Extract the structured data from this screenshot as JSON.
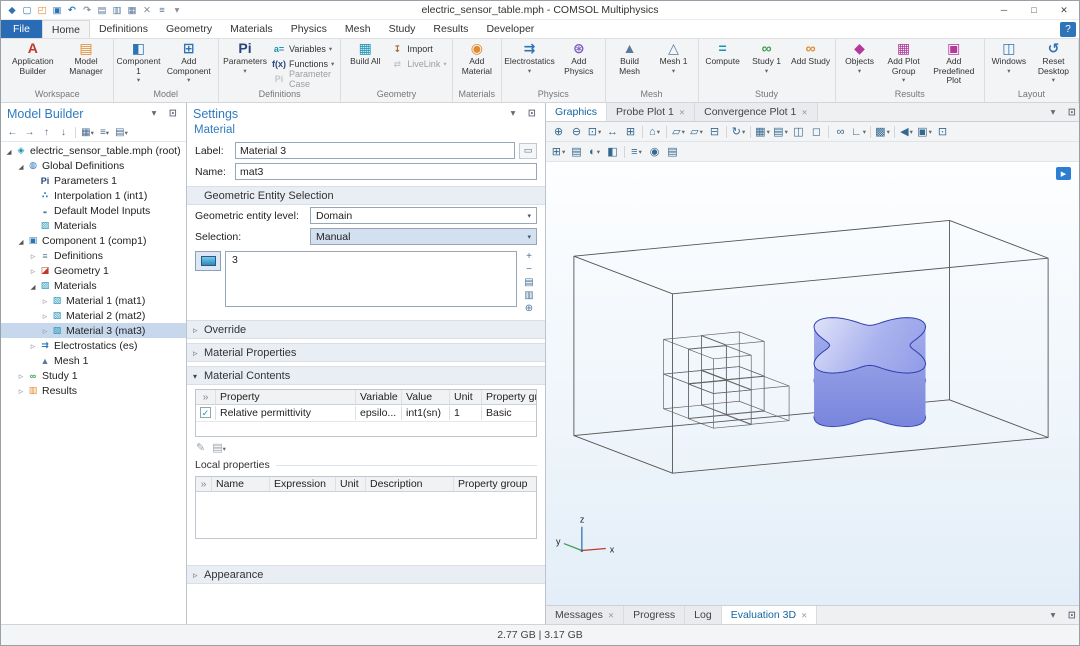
{
  "window": {
    "title": "electric_sensor_table.mph - COMSOL Multiphysics",
    "min": "─",
    "max": "□",
    "close": "✕",
    "quick_toolbar": [
      {
        "name": "app-icon",
        "g": "◆",
        "c": "blue"
      },
      {
        "name": "new-file-icon",
        "g": "▢",
        "c": "blue"
      },
      {
        "name": "open-file-icon",
        "g": "◰",
        "c": "orange"
      },
      {
        "name": "save-icon",
        "g": "▣",
        "c": "blue"
      },
      {
        "name": "undo-icon",
        "g": "↶",
        "c": "blue"
      },
      {
        "name": "redo-icon",
        "g": "↷",
        "c": "gray"
      },
      {
        "name": "copy-icon",
        "g": "▤",
        "c": "slate"
      },
      {
        "name": "paste-icon",
        "g": "▥",
        "c": "slate"
      },
      {
        "name": "duplicate-icon",
        "g": "▦",
        "c": "slate"
      },
      {
        "name": "delete-icon",
        "g": "✕",
        "c": "gray"
      },
      {
        "name": "options-icon",
        "g": "≡",
        "c": "slate"
      },
      {
        "name": "qat-menu-icon",
        "g": "▾",
        "c": "gray"
      }
    ]
  },
  "menubar": {
    "help": "?",
    "tabs": [
      {
        "label": "File",
        "cls": "file",
        "name": "tab-file"
      },
      {
        "label": "Home",
        "selected": true,
        "name": "tab-home"
      },
      {
        "label": "Definitions",
        "name": "tab-definitions"
      },
      {
        "label": "Geometry",
        "name": "tab-geometry"
      },
      {
        "label": "Materials",
        "name": "tab-materials"
      },
      {
        "label": "Physics",
        "name": "tab-physics"
      },
      {
        "label": "Mesh",
        "name": "tab-mesh"
      },
      {
        "label": "Study",
        "name": "tab-study"
      },
      {
        "label": "Results",
        "name": "tab-results"
      },
      {
        "label": "Developer",
        "name": "tab-developer"
      }
    ]
  },
  "ribbon": {
    "groups": [
      {
        "label": "Workspace",
        "big": [
          {
            "name": "application-builder-button",
            "label": "Application Builder",
            "g": "A",
            "c": "red"
          },
          {
            "name": "model-manager-button",
            "label": "Model Manager",
            "g": "▤",
            "c": "orange"
          }
        ],
        "small": []
      },
      {
        "label": "Model",
        "big": [
          {
            "name": "component-1-button",
            "label": "Component 1",
            "g": "◧",
            "c": "blue",
            "arrow": true
          },
          {
            "name": "add-component-button",
            "label": "Add Component",
            "g": "⊞",
            "c": "blue",
            "arrow": true
          }
        ],
        "small": []
      },
      {
        "label": "Definitions",
        "big": [
          {
            "name": "parameters-button",
            "label": "Parameters",
            "g": "Pi",
            "c": "navy",
            "arrow": true
          }
        ],
        "small": [
          {
            "name": "variables-button",
            "label": "Variables",
            "g": "a=",
            "c": "teal",
            "arrow": true
          },
          {
            "name": "functions-button",
            "label": "Functions",
            "g": "f(x)",
            "c": "navy",
            "arrow": true
          },
          {
            "name": "parameter-case-button",
            "label": "Parameter Case",
            "g": "Pi",
            "c": "gray",
            "disabled": true
          }
        ]
      },
      {
        "label": "Geometry",
        "big": [
          {
            "name": "build-all-button",
            "label": "Build All",
            "g": "▦",
            "c": "teal"
          }
        ],
        "small": [
          {
            "name": "import-button",
            "label": "Import",
            "g": "↧",
            "c": "brown"
          },
          {
            "name": "livelink-button",
            "label": "LiveLink",
            "g": "⇄",
            "c": "gray",
            "arrow": true,
            "disabled": true
          }
        ]
      },
      {
        "label": "Materials",
        "big": [
          {
            "name": "add-material-button",
            "label": "Add Material",
            "g": "◉",
            "c": "orange"
          }
        ],
        "small": []
      },
      {
        "label": "Physics",
        "big": [
          {
            "name": "electrostatics-button",
            "label": "Electrostatics",
            "g": "⇉",
            "c": "blue",
            "arrow": true
          },
          {
            "name": "add-physics-button",
            "label": "Add Physics",
            "g": "⊛",
            "c": "purple"
          }
        ],
        "small": []
      },
      {
        "label": "Mesh",
        "big": [
          {
            "name": "build-mesh-button",
            "label": "Build Mesh",
            "g": "▲",
            "c": "slate"
          },
          {
            "name": "mesh-1-button",
            "label": "Mesh 1",
            "g": "△",
            "c": "slate",
            "arrow": true
          }
        ],
        "small": []
      },
      {
        "label": "Study",
        "big": [
          {
            "name": "compute-button",
            "label": "Compute",
            "g": "=",
            "c": "teal"
          },
          {
            "name": "study-1-button",
            "label": "Study 1",
            "g": "∞",
            "c": "green",
            "arrow": true
          },
          {
            "name": "add-study-button",
            "label": "Add Study",
            "g": "∞",
            "c": "orange"
          }
        ],
        "small": []
      },
      {
        "label": "Results",
        "big": [
          {
            "name": "objects-button",
            "label": "Objects",
            "g": "◆",
            "c": "magenta",
            "arrow": true
          },
          {
            "name": "add-plot-group-button",
            "label": "Add Plot Group",
            "g": "▦",
            "c": "magenta",
            "arrow": true
          },
          {
            "name": "add-predefined-plot-button",
            "label": "Add Predefined Plot",
            "g": "▣",
            "c": "magenta"
          }
        ],
        "small": []
      },
      {
        "label": "Layout",
        "big": [
          {
            "name": "windows-button",
            "label": "Windows",
            "g": "◫",
            "c": "blue",
            "arrow": true
          },
          {
            "name": "reset-desktop-button",
            "label": "Reset Desktop",
            "g": "↺",
            "c": "blue",
            "arrow": true
          }
        ],
        "small": []
      }
    ]
  },
  "model_builder": {
    "title": "Model Builder",
    "corner": [
      {
        "name": "panel-menu-icon",
        "g": "▾"
      },
      {
        "name": "float-panel-icon",
        "g": "⊡"
      }
    ],
    "toolbar": [
      {
        "name": "back-icon",
        "g": "←"
      },
      {
        "name": "forward-icon",
        "g": "→"
      },
      {
        "name": "move-up-icon",
        "g": "↑"
      },
      {
        "name": "move-down-icon",
        "g": "↓"
      },
      {
        "name": "toolbar-separator",
        "cls": "sep",
        "noninteractable": true
      },
      {
        "name": "show-icon",
        "g": "▦",
        "arrow": true
      },
      {
        "name": "collapse-icon",
        "g": "≡",
        "arrow": true
      },
      {
        "name": "tree-menu-icon",
        "g": "▤",
        "arrow": true
      }
    ],
    "tree": [
      {
        "name": "tree-item-root",
        "exp": "open",
        "g": "◈",
        "c": "teal",
        "label": "electric_sensor_table.mph (root)",
        "indent": 0
      },
      {
        "name": "tree-item-global-definitions",
        "exp": "open",
        "g": "◍",
        "c": "blue",
        "label": "Global Definitions",
        "indent": 1
      },
      {
        "name": "tree-item-parameters-1",
        "exp": "none",
        "g": "Pi",
        "c": "navy",
        "label": "Parameters 1",
        "indent": 2
      },
      {
        "name": "tree-item-interpolation-1",
        "exp": "none",
        "g": "∴",
        "c": "blue",
        "label": "Interpolation 1 (int1)",
        "indent": 2
      },
      {
        "name": "tree-item-default-model-inputs",
        "exp": "none",
        "g": "◒",
        "c": "slate",
        "label": "Default Model Inputs",
        "indent": 2
      },
      {
        "name": "tree-item-materials-global",
        "exp": "none",
        "g": "▨",
        "c": "teal",
        "label": "Materials",
        "indent": 2
      },
      {
        "name": "tree-item-component-1",
        "exp": "open",
        "g": "▣",
        "c": "blue",
        "label": "Component 1 (comp1)",
        "indent": 1
      },
      {
        "name": "tree-item-definitions",
        "exp": "closed",
        "g": "≡",
        "c": "slate",
        "label": "Definitions",
        "indent": 2
      },
      {
        "name": "tree-item-geometry-1",
        "exp": "closed",
        "g": "◪",
        "c": "red",
        "label": "Geometry 1",
        "indent": 2
      },
      {
        "name": "tree-item-materials",
        "exp": "open",
        "g": "▨",
        "c": "teal",
        "label": "Materials",
        "indent": 2
      },
      {
        "name": "tree-item-material-1",
        "exp": "closed",
        "g": "▧",
        "c": "teal",
        "label": "Material 1 (mat1)",
        "indent": 3
      },
      {
        "name": "tree-item-material-2",
        "exp": "closed",
        "g": "▧",
        "c": "teal",
        "label": "Material 2 (mat2)",
        "indent": 3
      },
      {
        "name": "tree-item-material-3",
        "exp": "closed",
        "g": "▧",
        "c": "teal",
        "label": "Material 3 (mat3)",
        "indent": 3,
        "selected": true
      },
      {
        "name": "tree-item-electrostatics",
        "exp": "closed",
        "g": "⇉",
        "c": "blue",
        "label": "Electrostatics (es)",
        "indent": 2
      },
      {
        "name": "tree-item-mesh-1",
        "exp": "none",
        "g": "▲",
        "c": "slate",
        "label": "Mesh 1",
        "indent": 2
      },
      {
        "name": "tree-item-study-1",
        "exp": "closed",
        "g": "∞",
        "c": "green",
        "label": "Study 1",
        "indent": 1
      },
      {
        "name": "tree-item-results",
        "exp": "closed",
        "g": "▥",
        "c": "orange",
        "label": "Results",
        "indent": 1
      }
    ]
  },
  "settings": {
    "title": "Settings",
    "subtitle": "Material",
    "corner": [
      {
        "name": "panel-menu-icon",
        "g": "▾"
      },
      {
        "name": "float-panel-icon",
        "g": "⊡"
      }
    ],
    "label_label": "Label:",
    "label_value": "Material 3",
    "name_label": "Name:",
    "name_value": "mat3",
    "sections": {
      "ges": "Geometric Entity Selection",
      "override": "Override",
      "material_properties": "Material Properties",
      "material_contents": "Material Contents",
      "local_properties": "Local properties",
      "appearance": "Appearance"
    },
    "fields": {
      "level_label": "Geometric entity level:",
      "level_value": "Domain",
      "selection_label": "Selection:",
      "selection_value": "Manual"
    },
    "selection_items": [
      "3"
    ],
    "selection_tools": [
      {
        "name": "add-to-selection-icon",
        "g": "+"
      },
      {
        "name": "remove-from-selection-icon",
        "g": "−"
      },
      {
        "name": "copy-selection-icon",
        "g": "▤"
      },
      {
        "name": "paste-selection-icon",
        "g": "▥"
      },
      {
        "name": "zoom-to-selection-icon",
        "g": "⊕"
      }
    ],
    "material_contents": {
      "columns": [
        "»",
        "Property",
        "Variable",
        "Value",
        "Unit",
        "Property group"
      ],
      "rows": [
        {
          "checked": "✓",
          "property": "Relative permittivity",
          "variable": "epsilo...",
          "value": "int1(sn)",
          "unit": "1",
          "group": "Basic"
        }
      ]
    },
    "table_tools": [
      {
        "name": "edit-property-icon",
        "g": "✎"
      },
      {
        "name": "property-list-icon",
        "g": "▤",
        "arrow": true
      }
    ],
    "local_properties": {
      "columns": [
        "»",
        "Name",
        "Expression",
        "Unit",
        "Description",
        "Property group"
      ]
    }
  },
  "graphics": {
    "tabs": [
      {
        "label": "Graphics",
        "selected": true,
        "name": "tab-graphics"
      },
      {
        "label": "Probe Plot 1",
        "close": true,
        "name": "tab-probe-plot-1"
      },
      {
        "label": "Convergence Plot 1",
        "close": true,
        "name": "tab-convergence-plot-1"
      }
    ],
    "corner": [
      {
        "name": "panel-menu-icon",
        "g": "▾"
      },
      {
        "name": "float-panel-icon",
        "g": "⊡"
      }
    ],
    "toolbar1": [
      {
        "name": "zoom-in-icon",
        "g": "⊕"
      },
      {
        "name": "zoom-out-icon",
        "g": "⊖"
      },
      {
        "name": "zoom-box-icon",
        "g": "⊡",
        "arrow": true
      },
      {
        "name": "pan-icon",
        "g": "↔"
      },
      {
        "name": "zoom-extents-icon",
        "g": "⊞"
      },
      {
        "name": "toolbar-separator",
        "cls": "sep",
        "noninteractable": true
      },
      {
        "name": "go-to-default-view-icon",
        "g": "⌂",
        "arrow": true
      },
      {
        "name": "toolbar-separator",
        "cls": "sep",
        "noninteractable": true
      },
      {
        "name": "view-xy-icon",
        "g": "▱",
        "arrow": true
      },
      {
        "name": "view-yz-icon",
        "g": "▱",
        "arrow": true
      },
      {
        "name": "orthographic-icon",
        "g": "⊟"
      },
      {
        "name": "toolbar-separator",
        "cls": "sep",
        "noninteractable": true
      },
      {
        "name": "rotate-view-icon",
        "g": "↻",
        "arrow": true
      },
      {
        "name": "toolbar-separator",
        "cls": "sep",
        "noninteractable": true
      },
      {
        "name": "scene-settings-icon",
        "g": "▦",
        "arrow": true
      },
      {
        "name": "plot-settings-icon",
        "g": "▤",
        "arrow": true
      },
      {
        "name": "select-entities-icon",
        "g": "◫"
      },
      {
        "name": "clear-selection-icon",
        "g": "◻"
      },
      {
        "name": "toolbar-separator",
        "cls": "sep",
        "noninteractable": true
      },
      {
        "name": "probe-icon",
        "g": "∞"
      },
      {
        "name": "measure-icon",
        "g": "∟",
        "arrow": true
      },
      {
        "name": "toolbar-separator",
        "cls": "sep",
        "noninteractable": true
      },
      {
        "name": "color-theme-icon",
        "g": "▩",
        "arrow": true
      },
      {
        "name": "toolbar-separator",
        "cls": "sep",
        "noninteractable": true
      },
      {
        "name": "previous-view-icon",
        "g": "◀",
        "arrow": true
      },
      {
        "name": "capture-icon",
        "g": "▣",
        "arrow": true
      },
      {
        "name": "dock-icon",
        "g": "⊡"
      }
    ],
    "toolbar2": [
      {
        "name": "select-box-icon",
        "g": "⊞",
        "arrow": true
      },
      {
        "name": "selection-list-icon",
        "g": "▤"
      },
      {
        "name": "lighting-icon",
        "g": "◐",
        "arrow": true
      },
      {
        "name": "transparency-icon",
        "g": "◧"
      },
      {
        "name": "toolbar-separator",
        "cls": "sep",
        "noninteractable": true
      },
      {
        "name": "scene-options-icon",
        "g": "≡",
        "arrow": true
      },
      {
        "name": "screenshot-icon",
        "g": "◉"
      },
      {
        "name": "print-icon",
        "g": "▤"
      }
    ],
    "media_button": "▶",
    "axis_labels": {
      "x": "x",
      "y": "y",
      "z": "z"
    },
    "bottom_tabs": [
      {
        "label": "Messages",
        "close": true,
        "name": "tab-messages"
      },
      {
        "label": "Progress",
        "name": "tab-progress"
      },
      {
        "label": "Log",
        "name": "tab-log"
      },
      {
        "label": "Evaluation 3D",
        "close": true,
        "selected": true,
        "name": "tab-evaluation-3d"
      }
    ],
    "bottom_corner": [
      {
        "name": "panel-menu-icon",
        "g": "▾"
      },
      {
        "name": "float-panel-icon",
        "g": "⊡"
      }
    ]
  },
  "statusbar": {
    "text": "2.77 GB | 3.17 GB"
  }
}
